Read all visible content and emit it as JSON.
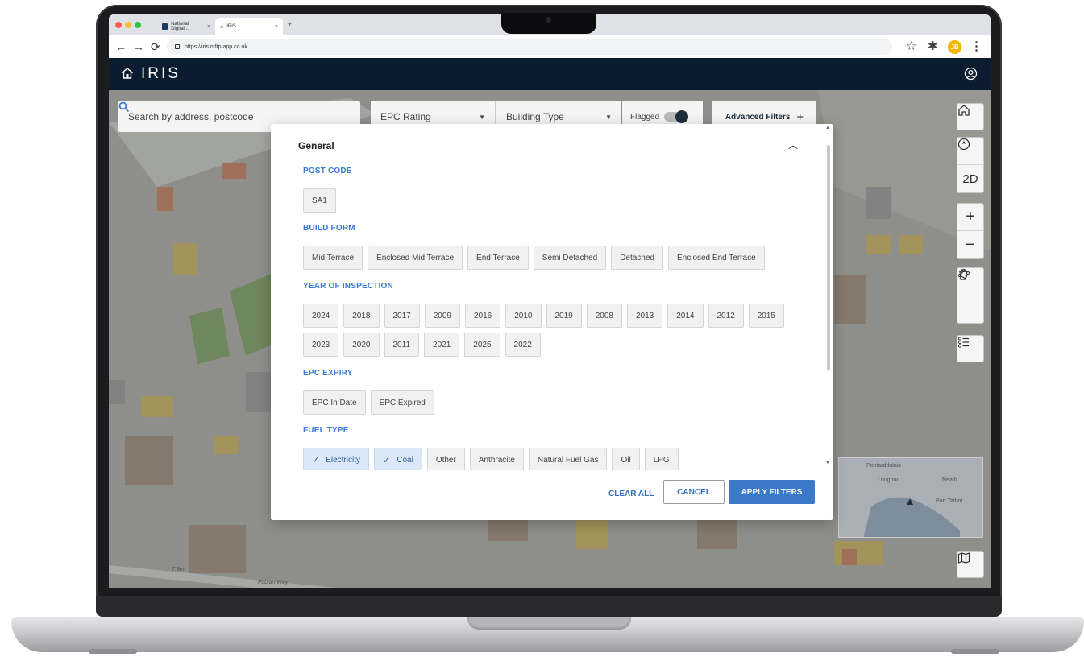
{
  "browser": {
    "tabs": [
      {
        "label": "National Digital..."
      },
      {
        "label": "IRIS"
      }
    ],
    "url": "https://iris.ndtp.app.co.uk",
    "profile_initials": "JB"
  },
  "app": {
    "title": "IRIS"
  },
  "toolbar": {
    "search_placeholder": "Search by address, postcode",
    "epc_rating_label": "EPC Rating",
    "building_type_label": "Building Type",
    "flagged_label": "Flagged",
    "advanced_filters_label": "Advanced Filters",
    "advanced_filters_icon": "+"
  },
  "map_controls": {
    "view_mode_label": "2D"
  },
  "map_labels": {
    "road_label": "Fabian Way",
    "height_label": "7.9m",
    "minimap_places": [
      "Pontarddulais",
      "Loughor",
      "Neath",
      "Port Talbot"
    ]
  },
  "modal": {
    "section_title": "General",
    "groups": {
      "post_code": {
        "label": "POST CODE",
        "options": [
          {
            "label": "SA1",
            "selected": false
          }
        ]
      },
      "build_form": {
        "label": "BUILD FORM",
        "options": [
          {
            "label": "Mid Terrace",
            "selected": false
          },
          {
            "label": "Enclosed Mid Terrace",
            "selected": false
          },
          {
            "label": "End Terrace",
            "selected": false
          },
          {
            "label": "Semi Detached",
            "selected": false
          },
          {
            "label": "Detached",
            "selected": false
          },
          {
            "label": "Enclosed End Terrace",
            "selected": false
          }
        ]
      },
      "year_of_inspection": {
        "label": "YEAR OF INSPECTION",
        "rows": [
          [
            "2024",
            "2018",
            "2017",
            "2009",
            "2016",
            "2010",
            "2019",
            "2008",
            "2013",
            "2014",
            "2012",
            "2015"
          ],
          [
            "2023",
            "2020",
            "2011",
            "2021",
            "2025",
            "2022"
          ]
        ]
      },
      "epc_expiry": {
        "label": "EPC EXPIRY",
        "options": [
          {
            "label": "EPC In Date",
            "selected": false
          },
          {
            "label": "EPC Expired",
            "selected": false
          }
        ]
      },
      "fuel_type": {
        "label": "FUEL TYPE",
        "options": [
          {
            "label": "Electricity",
            "selected": true
          },
          {
            "label": "Coal",
            "selected": true
          },
          {
            "label": "Other",
            "selected": false
          },
          {
            "label": "Anthracite",
            "selected": false
          },
          {
            "label": "Natural Fuel Gas",
            "selected": false
          },
          {
            "label": "Oil",
            "selected": false
          },
          {
            "label": "LPG",
            "selected": false
          }
        ]
      }
    },
    "actions": {
      "clear_all": "CLEAR ALL",
      "cancel": "CANCEL",
      "apply": "APPLY FILTERS"
    }
  },
  "colors": {
    "appbar": "#0b1c31",
    "accent": "#3a78c9",
    "group_label": "#3a7bd5",
    "chip_selected_bg": "#dbe8f7"
  }
}
